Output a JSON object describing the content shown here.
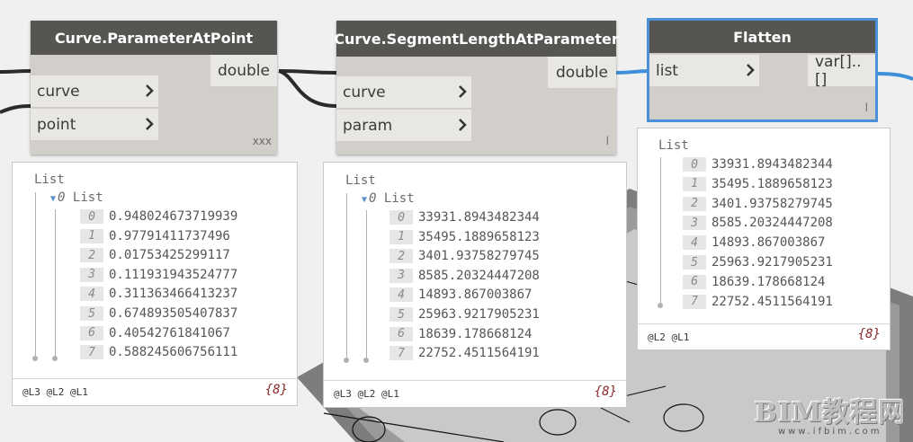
{
  "nodes": {
    "parameter_at_point": {
      "title": "Curve.ParameterAtPoint",
      "inputs": [
        "curve",
        "point"
      ],
      "output": "double",
      "lacing": "xxx"
    },
    "segment_length": {
      "title": "Curve.SegmentLengthAtParameter",
      "inputs": [
        "curve",
        "param"
      ],
      "output": "double",
      "lacing": "l"
    },
    "flatten": {
      "title": "Flatten",
      "inputs": [
        "list"
      ],
      "output": "var[]..[]",
      "lacing": "l"
    }
  },
  "previews": {
    "parameter_at_point": {
      "root_label": "List",
      "sub_index": "0",
      "sub_label": "List",
      "items": [
        {
          "index": "0",
          "value": "0.948024673719939"
        },
        {
          "index": "1",
          "value": "0.97791411737496"
        },
        {
          "index": "2",
          "value": "0.01753425299117"
        },
        {
          "index": "3",
          "value": "0.111931943524777"
        },
        {
          "index": "4",
          "value": "0.311363466413237"
        },
        {
          "index": "5",
          "value": "0.674893505407837"
        },
        {
          "index": "6",
          "value": "0.40542761841067"
        },
        {
          "index": "7",
          "value": "0.588245606756111"
        }
      ],
      "levels": "@L3 @L2 @L1",
      "count": "{8}"
    },
    "segment_length": {
      "root_label": "List",
      "sub_index": "0",
      "sub_label": "List",
      "items": [
        {
          "index": "0",
          "value": "33931.8943482344"
        },
        {
          "index": "1",
          "value": "35495.1889658123"
        },
        {
          "index": "2",
          "value": "3401.93758279745"
        },
        {
          "index": "3",
          "value": "8585.20324447208"
        },
        {
          "index": "4",
          "value": "14893.867003867"
        },
        {
          "index": "5",
          "value": "25963.9217905231"
        },
        {
          "index": "6",
          "value": "18639.178668124"
        },
        {
          "index": "7",
          "value": "22752.4511564191"
        }
      ],
      "levels": "@L3 @L2 @L1",
      "count": "{8}"
    },
    "flatten": {
      "root_label": "List",
      "items": [
        {
          "index": "0",
          "value": "33931.8943482344"
        },
        {
          "index": "1",
          "value": "35495.1889658123"
        },
        {
          "index": "2",
          "value": "3401.93758279745"
        },
        {
          "index": "3",
          "value": "8585.20324447208"
        },
        {
          "index": "4",
          "value": "14893.867003867"
        },
        {
          "index": "5",
          "value": "25963.9217905231"
        },
        {
          "index": "6",
          "value": "18639.178668124"
        },
        {
          "index": "7",
          "value": "22752.4511564191"
        }
      ],
      "levels": "@L2 @L1",
      "count": "{8}"
    }
  },
  "watermark": {
    "main": "BIM教程网",
    "url": "www.ifbim.com"
  },
  "colors": {
    "node_header": "#575552",
    "node_body": "#d2cfca",
    "port_bg": "#e9e7e3",
    "selection": "#4a90d9",
    "wire_dark": "#2b2b2b",
    "wire_blue": "#3c8fd8"
  },
  "icons": [
    "chevron-right-icon",
    "list-expand-triangle-icon"
  ]
}
